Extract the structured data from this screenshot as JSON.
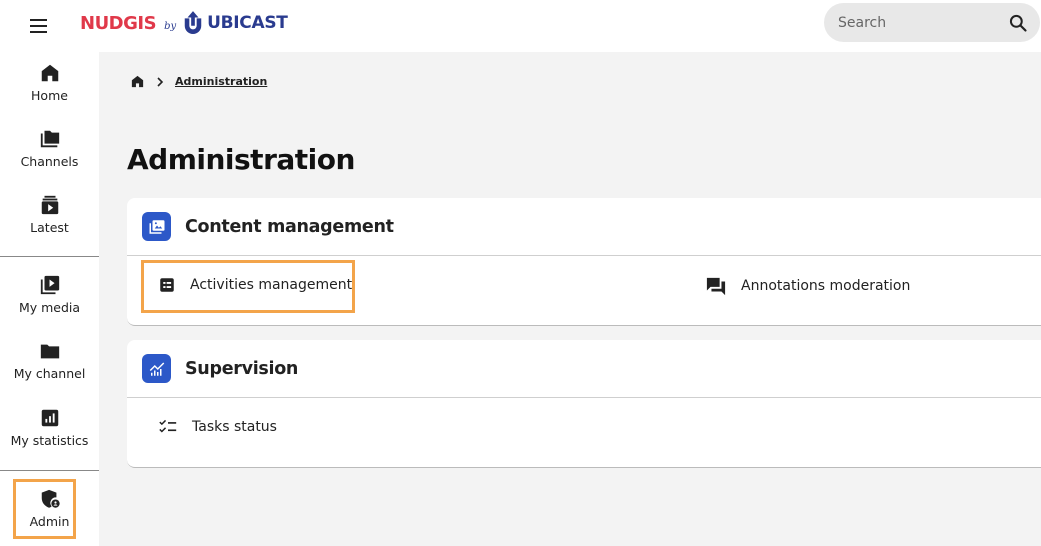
{
  "header": {
    "menu_icon": "hamburger-menu-icon",
    "logo": {
      "brand": "NUDGIS",
      "by": "by",
      "company": "UBICAST"
    },
    "search": {
      "placeholder": "Search",
      "icon": "search-icon"
    }
  },
  "sidebar": {
    "items": [
      {
        "label": "Home",
        "icon": "home-icon"
      },
      {
        "label": "Channels",
        "icon": "folder-stack-icon"
      },
      {
        "label": "Latest",
        "icon": "latest-video-icon"
      },
      {
        "label": "My media",
        "icon": "media-play-icon"
      },
      {
        "label": "My channel",
        "icon": "folder-icon"
      },
      {
        "label": "My statistics",
        "icon": "statistics-icon"
      },
      {
        "label": "Admin",
        "icon": "admin-shield-icon"
      }
    ],
    "highlighted_item": "Admin"
  },
  "breadcrumb": {
    "home_icon": "home-icon",
    "current": "Administration"
  },
  "main": {
    "title": "Administration",
    "sections": [
      {
        "title": "Content management",
        "icon": "content-management-icon",
        "links": [
          {
            "label": "Activities management",
            "icon": "list-icon",
            "highlighted": true
          },
          {
            "label": "Annotations moderation",
            "icon": "comments-icon"
          }
        ]
      },
      {
        "title": "Supervision",
        "icon": "supervision-chart-icon",
        "links": [
          {
            "label": "Tasks status",
            "icon": "checklist-icon"
          }
        ]
      }
    ]
  },
  "colors": {
    "brand_red": "#e0394a",
    "brand_blue": "#2a3b8f",
    "section_icon_bg": "#2c58c8",
    "highlight_orange": "#f3a44a",
    "page_bg": "#f3f3f3"
  }
}
